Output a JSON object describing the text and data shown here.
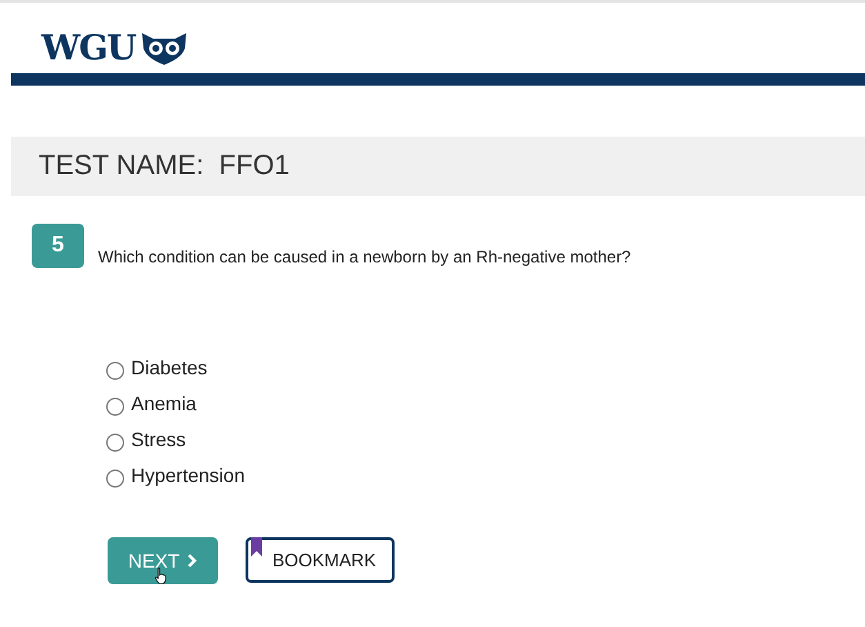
{
  "header": {
    "logo_text": "WGU"
  },
  "test_name": "TEST NAME:  FFO1",
  "question": {
    "number": "5",
    "text": "Which condition can be caused in a newborn by an Rh-negative mother?"
  },
  "options": [
    {
      "label": "Diabetes",
      "selected": false
    },
    {
      "label": "Anemia",
      "selected": false
    },
    {
      "label": "Stress",
      "selected": false
    },
    {
      "label": "Hypertension",
      "selected": false
    }
  ],
  "buttons": {
    "next": "NEXT",
    "bookmark": "BOOKMARK"
  }
}
